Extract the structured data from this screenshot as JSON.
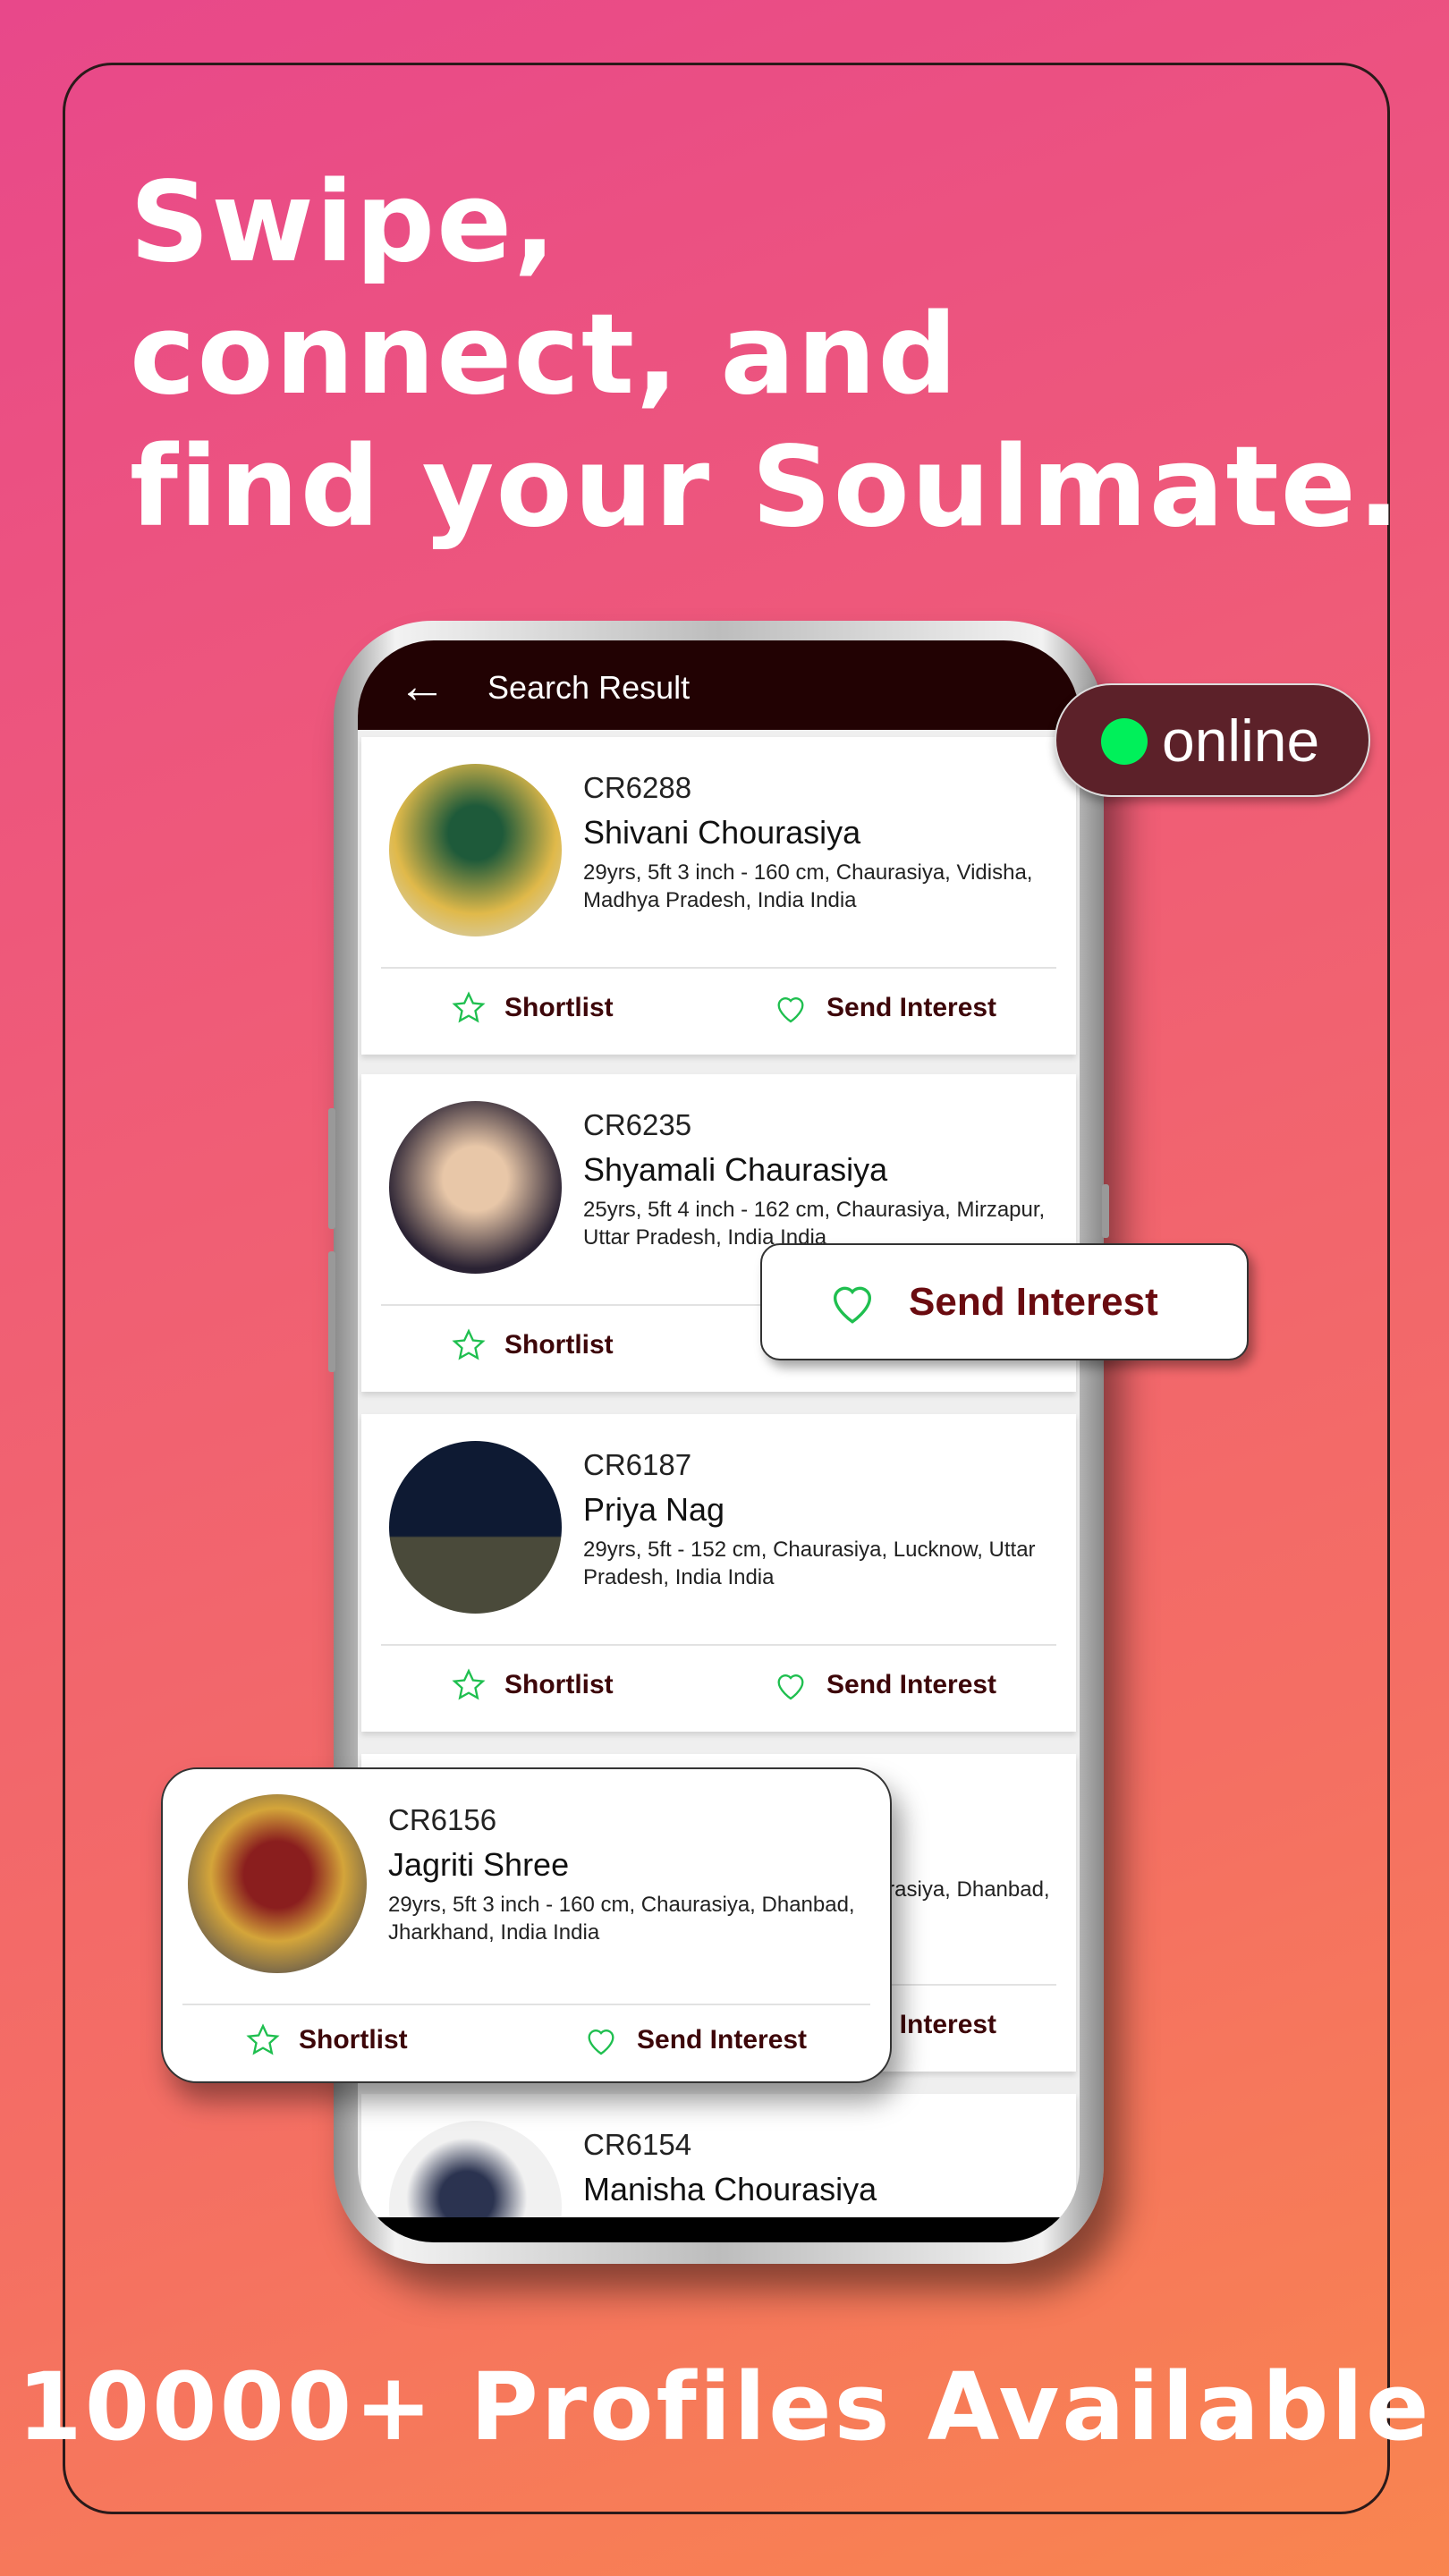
{
  "headline": [
    "Swipe,",
    "connect, and",
    "find your Soulmate."
  ],
  "footer": "10000+ Profiles Available",
  "app": {
    "title": "Search Result",
    "back_icon": "arrow-left-icon"
  },
  "online_badge": {
    "label": "online",
    "dot_color": "#00f05a"
  },
  "send_interest_popup": {
    "label": "Send Interest"
  },
  "actions": {
    "shortlist": "Shortlist",
    "send_interest": "Send Interest"
  },
  "colors": {
    "app_bar": "#220203",
    "action_text": "#3d0609",
    "icon_green": "#1fbf4f"
  },
  "profiles": [
    {
      "id": "CR6288",
      "name": "Shivani Chourasiya",
      "details": "29yrs, 5ft 3 inch - 160 cm, Chaurasiya, Vidisha, Madhya Pradesh, India India"
    },
    {
      "id": "CR6235",
      "name": "Shyamali Chaurasiya",
      "details": "25yrs, 5ft 4 inch - 162 cm, Chaurasiya, Mirzapur, Uttar Pradesh, India India"
    },
    {
      "id": "CR6187",
      "name": "Priya Nag",
      "details": "29yrs, 5ft - 152 cm, Chaurasiya, Lucknow, Uttar Pradesh, India India"
    },
    {
      "id": "CR6156",
      "name": "Jagriti Shree",
      "details": "29yrs, 5ft 3 inch - 160 cm, Chaurasiya, Dhanbad, Jharkhand, India India"
    },
    {
      "id": "CR6154",
      "name": "Manisha Chourasiya",
      "details": ""
    }
  ],
  "featured_profile_index": 3
}
